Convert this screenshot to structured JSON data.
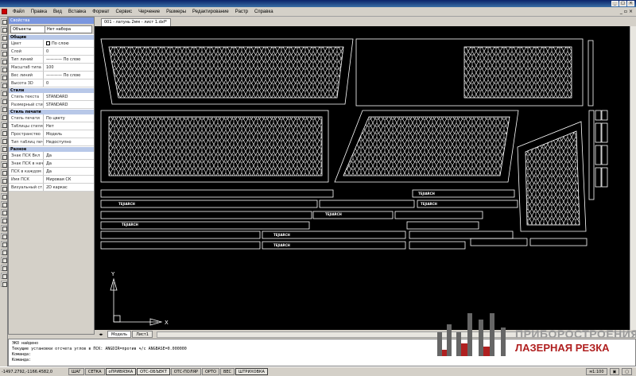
{
  "menu": [
    "Файл",
    "Правка",
    "Вид",
    "Вставка",
    "Формат",
    "Сервис",
    "Черчение",
    "Размеры",
    "Редактирование",
    "Растр",
    "Справка"
  ],
  "properties": {
    "header": "Свойства",
    "object_label": "Объекты",
    "object_value": "Нет набора",
    "sections": [
      {
        "title": "Общие",
        "rows": [
          {
            "k": "Цвет",
            "v": "По слою",
            "swatch": true
          },
          {
            "k": "Слой",
            "v": "0"
          },
          {
            "k": "Тип линий",
            "v": "———— По слою"
          },
          {
            "k": "Масштаб типа",
            "v": "100"
          },
          {
            "k": "Вес линий",
            "v": "———— По слою"
          },
          {
            "k": "Высота 3D",
            "v": "0"
          }
        ]
      },
      {
        "title": "Стили",
        "rows": [
          {
            "k": "Стиль текста",
            "v": "STANDARD"
          },
          {
            "k": "Размерный сти...",
            "v": "STANDARD"
          }
        ]
      },
      {
        "title": "Стиль печати",
        "rows": [
          {
            "k": "Стиль печати",
            "v": "По цвету"
          },
          {
            "k": "Таблицы стиля...",
            "v": "Нет"
          },
          {
            "k": "Пространство",
            "v": "Модель"
          },
          {
            "k": "Тип таблиц печ...",
            "v": "Недоступно"
          }
        ]
      },
      {
        "title": "Разное",
        "rows": [
          {
            "k": "Знак ПСК Вкл",
            "v": "Да"
          },
          {
            "k": "Знак ПСК в нач...",
            "v": "Да"
          },
          {
            "k": "ПСК в каждом ...",
            "v": "Да"
          },
          {
            "k": "Имя ПСК",
            "v": "Мировая СК"
          },
          {
            "k": "Визуальный ст...",
            "v": "2D каркас"
          }
        ]
      }
    ]
  },
  "document_tab": "001 - латунь 2мм - лист 1.dxf*",
  "layout_tabs": [
    "Модель",
    "Лист1"
  ],
  "drawing": {
    "text_labels": [
      "TEJIARCH",
      "TEJIARCH",
      "TEJIARCH",
      "TEJIARCH",
      "TEJIARCH",
      "TEJIARCH",
      "TEJIARCH"
    ],
    "axis_y": "Y",
    "axis_x": "X"
  },
  "command": {
    "lines": [
      "ЭКО  найдено",
      "Текущие установки отсчета углов в ПСК:  ANGDIR=против ч/с   ANGBASE=0.000000",
      "Команда:",
      "Команда:"
    ]
  },
  "status": {
    "coords": "-1497.2792,-1166.4582,0",
    "toggles": [
      {
        "label": "ШАГ",
        "on": false
      },
      {
        "label": "СЕТКА",
        "on": false
      },
      {
        "label": "оПРИВЯЗКА",
        "on": true
      },
      {
        "label": "ОТС-ОБЪЕКТ",
        "on": true
      },
      {
        "label": "ОТС-ПОЛЯР",
        "on": false
      },
      {
        "label": "ОРТО",
        "on": false
      },
      {
        "label": "ВЕС",
        "on": false
      },
      {
        "label": "ШТРИХОВКА",
        "on": true
      }
    ],
    "scale": "м1:100"
  },
  "watermark": {
    "line1": "ПРИБОРОСТРОЕНИЯ",
    "line2": "ЛАЗЕРНАЯ РЕЗКА"
  }
}
